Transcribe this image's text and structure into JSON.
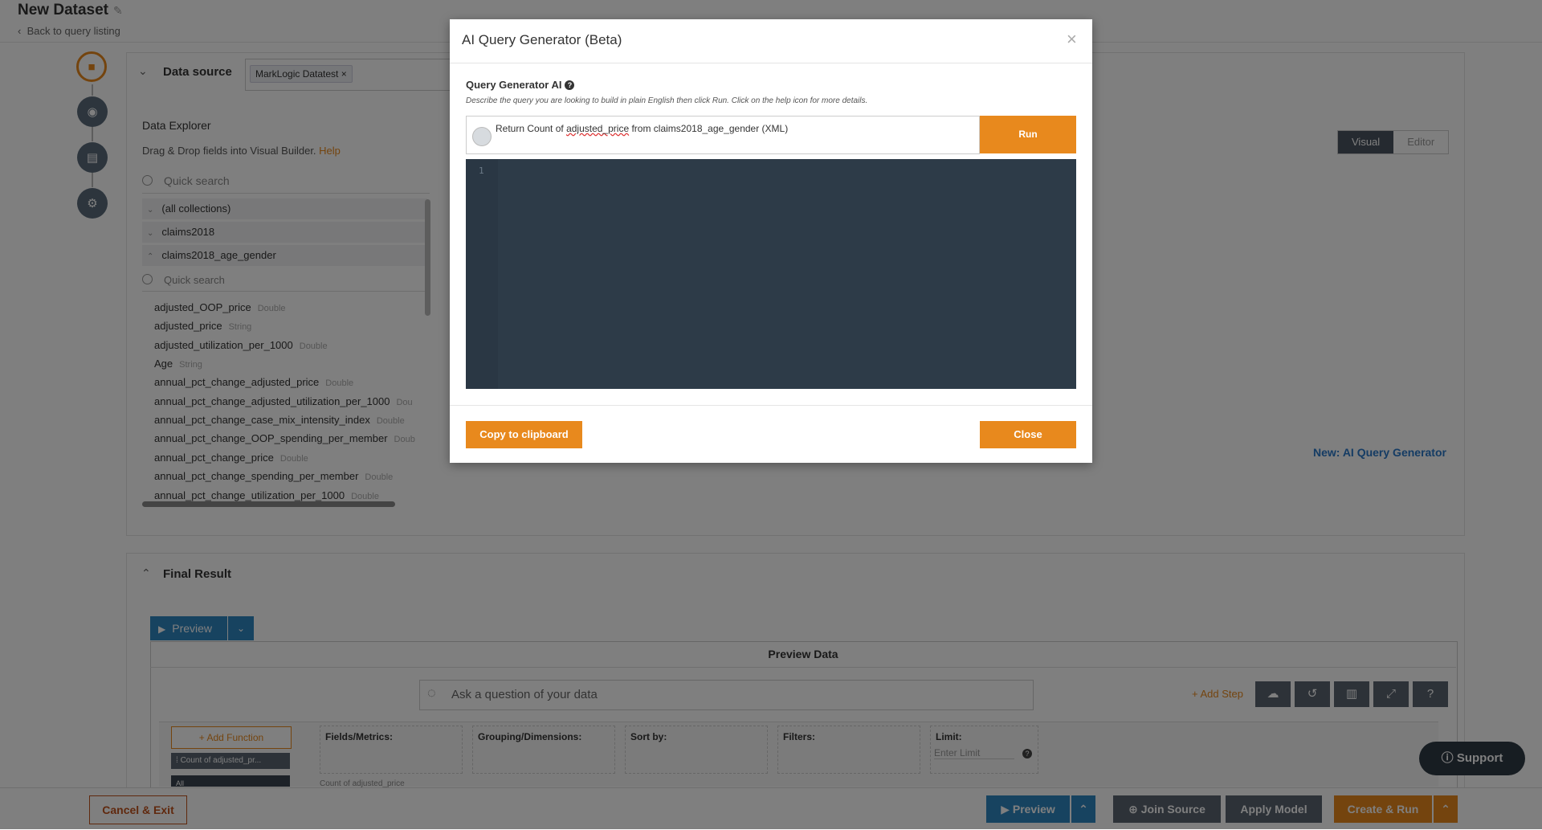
{
  "page": {
    "title": "New Dataset",
    "back_link": "Back to query listing"
  },
  "data_source": {
    "label": "Data source",
    "selected_tag": "MarkLogic Datatest"
  },
  "explorer": {
    "title": "Data Explorer",
    "subtitle": "Drag & Drop fields into Visual Builder.",
    "help_link": "Help",
    "search_placeholder": "Quick search",
    "collections": [
      "(all collections)",
      "claims2018",
      "claims2018_age_gender"
    ],
    "fields_search_placeholder": "Quick search",
    "fields": [
      {
        "name": "adjusted_OOP_price",
        "type": "Double"
      },
      {
        "name": "adjusted_price",
        "type": "String"
      },
      {
        "name": "adjusted_utilization_per_1000",
        "type": "Double"
      },
      {
        "name": "Age",
        "type": "String"
      },
      {
        "name": "annual_pct_change_adjusted_price",
        "type": "Double"
      },
      {
        "name": "annual_pct_change_adjusted_utilization_per_1000",
        "type": "Dou"
      },
      {
        "name": "annual_pct_change_case_mix_intensity_index",
        "type": "Double"
      },
      {
        "name": "annual_pct_change_OOP_spending_per_member",
        "type": "Doub"
      },
      {
        "name": "annual_pct_change_price",
        "type": "Double"
      },
      {
        "name": "annual_pct_change_spending_per_member",
        "type": "Double"
      },
      {
        "name": "annual_pct_change_utilization_per_1000",
        "type": "Double"
      }
    ]
  },
  "mode_toggle": {
    "visual": "Visual",
    "editor": "Editor"
  },
  "ai_link": "New: AI Query Generator",
  "final_result": {
    "label": "Final Result",
    "preview_button": "Preview",
    "preview_data_title": "Preview Data",
    "ask_placeholder": "Ask a question of your data",
    "add_step": "Add Step",
    "add_function": "Add Function",
    "function_chip": "Count of adjusted_pr...",
    "function_chip2": "All",
    "columns": {
      "fields": "Fields/Metrics:",
      "grouping": "Grouping/Dimensions:",
      "sort": "Sort by:",
      "filters": "Filters:",
      "limit": "Limit:"
    },
    "limit_placeholder": "Enter Limit",
    "count_label": "Count of adjusted_price"
  },
  "bottom_bar": {
    "cancel": "Cancel & Exit",
    "preview": "Preview",
    "join_source": "Join Source",
    "apply_model": "Apply Model",
    "create_run": "Create & Run"
  },
  "support": "Support",
  "modal": {
    "title": "AI Query Generator (Beta)",
    "label": "Query Generator AI",
    "description": "Describe the query you are looking to build in plain English then click Run. Click on the help icon for more details.",
    "query_prefix": "Return Count of ",
    "query_field": "adjusted_price",
    "query_suffix": " from claims2018_age_gender (XML)",
    "run_button": "Run",
    "line_number": "1",
    "copy_button": "Copy to clipboard",
    "close_button": "Close"
  },
  "colors": {
    "accent": "#e8891d",
    "editor_bg": "#2d3b48",
    "link_blue": "#2a78c8",
    "dark_button": "#5a6470"
  }
}
